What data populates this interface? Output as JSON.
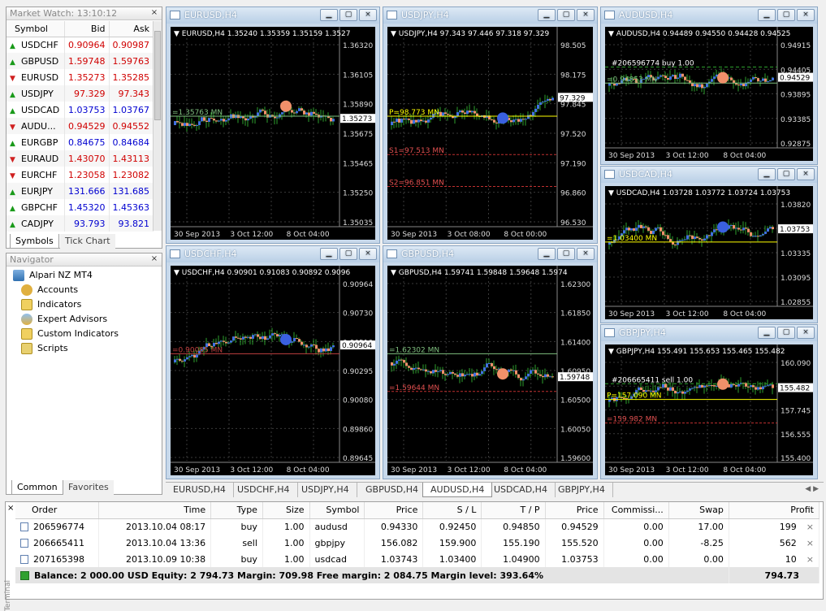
{
  "market_watch": {
    "title": "Market Watch: 13:10:12",
    "columns": [
      "Symbol",
      "Bid",
      "Ask"
    ],
    "rows": [
      {
        "dir": "up",
        "symbol": "USDCHF",
        "bid": "0.90964",
        "ask": "0.90987",
        "color": "red"
      },
      {
        "dir": "up",
        "symbol": "GBPUSD",
        "bid": "1.59748",
        "ask": "1.59763",
        "color": "red"
      },
      {
        "dir": "dn",
        "symbol": "EURUSD",
        "bid": "1.35273",
        "ask": "1.35285",
        "color": "red"
      },
      {
        "dir": "up",
        "symbol": "USDJPY",
        "bid": "97.329",
        "ask": "97.343",
        "color": "red"
      },
      {
        "dir": "up",
        "symbol": "USDCAD",
        "bid": "1.03753",
        "ask": "1.03767",
        "color": "blue"
      },
      {
        "dir": "dn",
        "symbol": "AUDU...",
        "bid": "0.94529",
        "ask": "0.94552",
        "color": "red"
      },
      {
        "dir": "up",
        "symbol": "EURGBP",
        "bid": "0.84675",
        "ask": "0.84684",
        "color": "blue"
      },
      {
        "dir": "dn",
        "symbol": "EURAUD",
        "bid": "1.43070",
        "ask": "1.43113",
        "color": "red"
      },
      {
        "dir": "dn",
        "symbol": "EURCHF",
        "bid": "1.23058",
        "ask": "1.23082",
        "color": "red"
      },
      {
        "dir": "up",
        "symbol": "EURJPY",
        "bid": "131.666",
        "ask": "131.685",
        "color": "blue"
      },
      {
        "dir": "up",
        "symbol": "GBPCHF",
        "bid": "1.45320",
        "ask": "1.45363",
        "color": "blue"
      },
      {
        "dir": "up",
        "symbol": "CADJPY",
        "bid": "93.793",
        "ask": "93.821",
        "color": "blue"
      }
    ],
    "tabs": [
      "Symbols",
      "Tick Chart"
    ]
  },
  "navigator": {
    "title": "Navigator",
    "items": [
      "Alpari NZ MT4",
      "Accounts",
      "Indicators",
      "Expert Advisors",
      "Custom Indicators",
      "Scripts"
    ],
    "tabs": [
      "Common",
      "Favorites"
    ]
  },
  "close_glyph": "×",
  "charts": [
    {
      "win_title": "EURUSD,H4",
      "header": "EURUSD,H4  1.35240 1.35359 1.35159 1.3527",
      "prices": [
        "1.36320",
        "1.36105",
        "1.35890",
        "1.35675",
        "1.35465",
        "1.35250",
        "1.35035"
      ],
      "dates": [
        "30 Sep 2013",
        "3 Oct 12:00",
        "8 Oct 04:00"
      ],
      "current": "1.35273",
      "line_label": "=1.35763 MN",
      "line_color": "#7fbf7f"
    },
    {
      "win_title": "USDJPY,H4",
      "header": "USDJPY,H4  97.343 97.446 97.318 97.329",
      "prices": [
        "98.505",
        "98.175",
        "97.845",
        "97.520",
        "97.190",
        "96.860",
        "96.530"
      ],
      "dates": [
        "30 Sep 2013",
        "3 Oct 08:00",
        "8 Oct 00:00"
      ],
      "current": "97.329",
      "line_label": "P=98.773 MN",
      "line_color": "#ffff00",
      "extra_labels": [
        "S1=97.513 MN",
        "S2=96.851 MN"
      ]
    },
    {
      "win_title": "AUDUSD,H4",
      "header": "AUDUSD,H4  0.94489 0.94550 0.94428 0.94525",
      "prices": [
        "0.94915",
        "0.94405",
        "0.93895",
        "0.93385",
        "0.92875"
      ],
      "dates": [
        "30 Sep 2013",
        "3 Oct 12:00",
        "8 Oct 04:00"
      ],
      "current": "0.94529",
      "line_label": "=0.94853 MN",
      "line_color": "#7fbf7f",
      "order_label": "#206596774 buy 1.00"
    },
    {
      "win_title": "USDCHF,H4",
      "header": "USDCHF,H4  0.90901 0.91083 0.90892 0.9096",
      "prices": [
        "0.90964",
        "0.90730",
        "0.90510",
        "0.90295",
        "0.90080",
        "0.89860",
        "0.89645"
      ],
      "dates": [
        "30 Sep 2013",
        "3 Oct 12:00",
        "8 Oct 04:00"
      ],
      "current": "0.90964",
      "line_label": "=0.90085 MN",
      "line_color": "#c04040"
    },
    {
      "win_title": "GBPUSD,H4",
      "header": "GBPUSD,H4  1.59741 1.59848 1.59648 1.5974",
      "prices": [
        "1.62300",
        "1.61850",
        "1.61400",
        "1.60950",
        "1.60500",
        "1.60050",
        "1.59600"
      ],
      "dates": [
        "30 Sep 2013",
        "3 Oct 12:00",
        "8 Oct 04:00"
      ],
      "current": "1.59748",
      "line_label": "=1.62302 MN",
      "line_color": "#7fbf7f",
      "extra_labels": [
        "=1.59644 MN"
      ]
    },
    {
      "win_title": "USDCAD,H4",
      "header": "USDCAD,H4  1.03728 1.03772 1.03724 1.03753",
      "prices": [
        "1.03820",
        "1.03580",
        "1.03335",
        "1.03095",
        "1.02855"
      ],
      "dates": [
        "30 Sep 2013",
        "3 Oct 12:00",
        "8 Oct 04:00"
      ],
      "current": "1.03753",
      "line_label": "=1.03400 MN",
      "line_color": "#ffff00"
    },
    {
      "win_title": "GBPJPY,H4",
      "header": "GBPJPY,H4  155.491 155.653 155.465 155.482",
      "prices": [
        "160.090",
        "158.900",
        "157.745",
        "156.555",
        "155.400"
      ],
      "dates": [
        "30 Sep 2013",
        "3 Oct 12:00",
        "8 Oct 04:00"
      ],
      "current": "155.482",
      "line_label": "P=157.090 MN",
      "line_color": "#ffff00",
      "order_label": "#206665411 sell 1.00",
      "extra_labels": [
        "=159.982 MN"
      ]
    }
  ],
  "bottom_tabs": [
    "EURUSD,H4",
    "USDCHF,H4",
    "USDJPY,H4",
    "GBPUSD,H4",
    "AUDUSD,H4",
    "USDCAD,H4",
    "GBPJPY,H4"
  ],
  "active_tab": "AUDUSD,H4",
  "terminal": {
    "side_label": "Terminal",
    "columns": [
      "Order",
      "Time",
      "Type",
      "Size",
      "Symbol",
      "Price",
      "S / L",
      "T / P",
      "Price",
      "Commissi...",
      "Swap",
      "Profit"
    ],
    "rows": [
      [
        "206596774",
        "2013.10.04 08:17",
        "buy",
        "1.00",
        "audusd",
        "0.94330",
        "0.92450",
        "0.94850",
        "0.94529",
        "0.00",
        "17.00",
        "199"
      ],
      [
        "206665411",
        "2013.10.04 13:36",
        "sell",
        "1.00",
        "gbpjpy",
        "156.082",
        "159.900",
        "155.190",
        "155.520",
        "0.00",
        "-8.25",
        "562"
      ],
      [
        "207165398",
        "2013.10.09 10:38",
        "buy",
        "1.00",
        "usdcad",
        "1.03743",
        "1.03400",
        "1.04900",
        "1.03753",
        "0.00",
        "0.00",
        "10"
      ]
    ],
    "balance_text": "Balance: 2 000.00 USD  Equity: 2 794.73  Margin: 709.98  Free margin: 2 084.75  Margin level: 393.64%",
    "balance_profit": "794.73"
  }
}
